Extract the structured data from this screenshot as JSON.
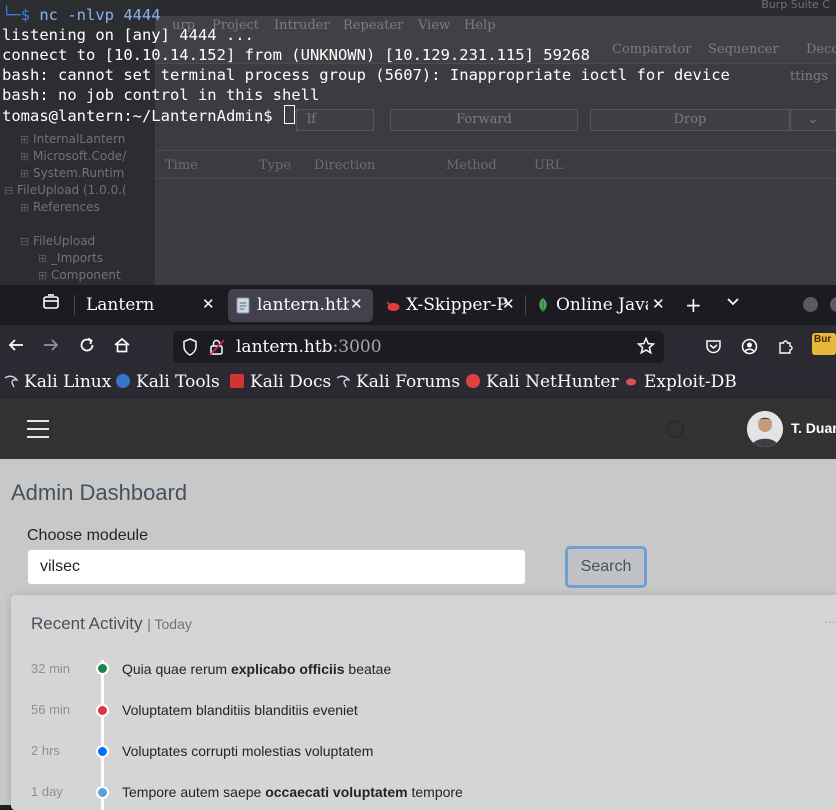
{
  "burp": {
    "title": "Burp Suite C",
    "menu": [
      "urp",
      "Project",
      "Intruder",
      "Repeater",
      "View",
      "Help"
    ],
    "tabs": [
      "Comparator",
      "Sequencer",
      "Deco"
    ],
    "settings_label": "ttings",
    "filter_label": "lf",
    "forward_label": "Forward",
    "drop_label": "Drop",
    "columns": [
      "Time",
      "Type",
      "Direction",
      "Method",
      "URL"
    ],
    "tree": [
      "InternalLantern",
      "Microsoft.Code/",
      "System.Runtim",
      "FileUpload (1.0.0.(",
      "References",
      "FileUpload",
      "_Imports",
      "Component"
    ]
  },
  "terminal": {
    "lines": [
      "nc -nlvp 4444",
      "listening on [any] 4444 ...",
      "connect to [10.10.14.152] from (UNKNOWN) [10.129.231.115] 59268",
      "bash: cannot set terminal process group (5607): Inappropriate ioctl for device",
      "bash: no job control in this shell",
      "tomas@lantern:~/LanternAdmin$ "
    ],
    "prompt_prefix": "└─$ "
  },
  "browser": {
    "tabs": [
      {
        "label": "Lantern"
      },
      {
        "label": "lantern.htb"
      },
      {
        "label": "X-Skipper-P"
      },
      {
        "label": "Online Java"
      }
    ],
    "url_host": "lantern.htb",
    "url_port": ":3000",
    "bookmarks": [
      "Kali Linux",
      "Kali Tools",
      "Kali Docs",
      "Kali Forums",
      "Kali NetHunter",
      "Exploit-DB"
    ],
    "burp_badge": "Bur"
  },
  "app": {
    "user_name": "T. Duar",
    "page_title": "Admin Dashboard",
    "module_label": "Choose modeule",
    "module_value": "vilsec",
    "search_label": "Search",
    "card_title": "Recent Activity",
    "card_sub": "| Today",
    "card_dots": "...",
    "activity": [
      {
        "time": "32 min",
        "color": "#198754",
        "pre": "Quia quae rerum ",
        "bold": "explicabo officiis",
        "post": " beatae"
      },
      {
        "time": "56 min",
        "color": "#dc3545",
        "pre": "Voluptatem blanditiis blanditiis eveniet",
        "bold": "",
        "post": ""
      },
      {
        "time": "2 hrs",
        "color": "#0d6efd",
        "pre": "Voluptates corrupti molestias voluptatem",
        "bold": "",
        "post": ""
      },
      {
        "time": "1 day",
        "color": "#5aa0d6",
        "pre": "Tempore autem saepe ",
        "bold": "occaecati voluptatem",
        "post": " tempore"
      }
    ]
  }
}
